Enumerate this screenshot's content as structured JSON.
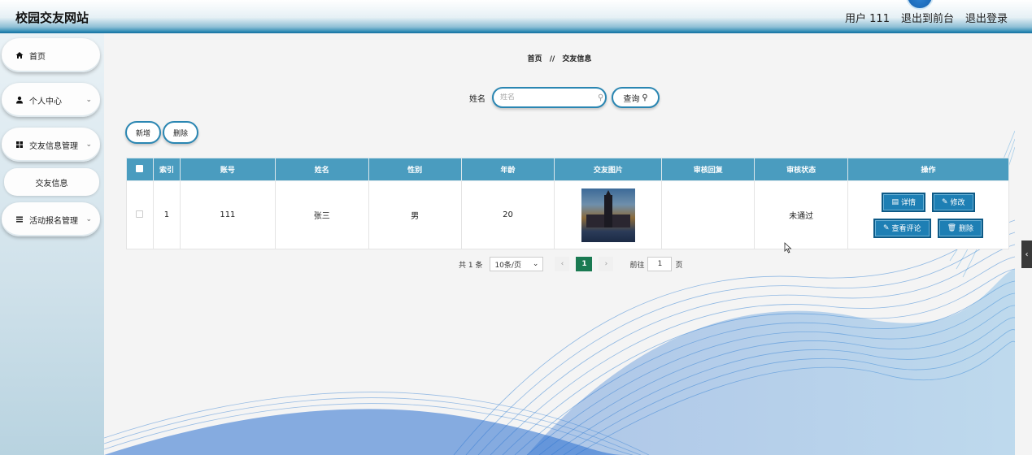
{
  "header": {
    "site_title": "校园交友网站",
    "user_label": "用户 111",
    "frontend_link": "退出到前台",
    "logout_link": "退出登录"
  },
  "sidebar": {
    "items": [
      {
        "label": "首页",
        "icon": "home-icon"
      },
      {
        "label": "个人中心",
        "icon": "user-icon"
      },
      {
        "label": "交友信息管理",
        "icon": "grid-icon"
      },
      {
        "label": "交友信息",
        "icon": ""
      },
      {
        "label": "活动报名管理",
        "icon": "list-icon"
      }
    ]
  },
  "breadcrumb": {
    "home": "首页",
    "separator": "//",
    "current": "交友信息"
  },
  "search": {
    "label": "姓名",
    "placeholder": "姓名",
    "button_label": "查询"
  },
  "actions": {
    "add_label": "新增",
    "delete_label": "删除"
  },
  "table": {
    "columns": [
      "索引",
      "账号",
      "姓名",
      "性别",
      "年龄",
      "交友图片",
      "审核回复",
      "审核状态",
      "操作"
    ],
    "rows": [
      {
        "index": "1",
        "account": "111",
        "name": "张三",
        "gender": "男",
        "age": "20",
        "reply": "",
        "status": "未通过"
      }
    ],
    "row_actions": {
      "detail": "详情",
      "edit": "修改",
      "view_comments": "查看评论",
      "delete": "删除"
    }
  },
  "pagination": {
    "total": "共 1 条",
    "page_size": "10条/页",
    "current_page": "1",
    "goto_label": "前往",
    "goto_value": "1",
    "page_suffix": "页"
  },
  "colors": {
    "header_accent": "#1f7aa8",
    "table_header": "#4a9cbf",
    "op_button": "#1e7fb4",
    "active_page": "#1a7a52"
  }
}
